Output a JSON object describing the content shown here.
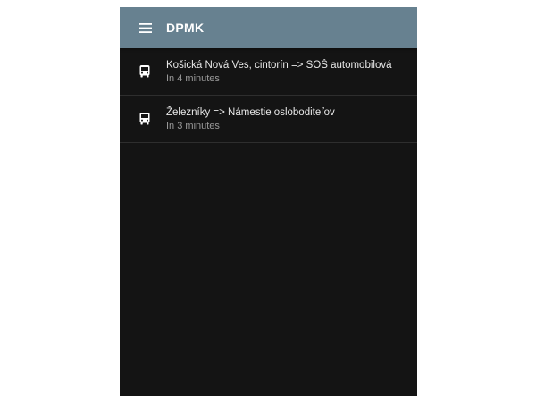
{
  "app": {
    "title": "DPMK"
  },
  "colors": {
    "appbar": "#678190",
    "background": "#141414",
    "primary_text": "#e8e8e8",
    "secondary_text": "#9a9a9a"
  },
  "icons": {
    "menu": "hamburger-menu-icon",
    "bus": "bus-icon"
  },
  "departures": [
    {
      "route": "Košická Nová Ves,  cintorín => SOŠ automobilová",
      "eta": "In 4 minutes"
    },
    {
      "route": "Železníky => Námestie osloboditeľov",
      "eta": "In 3 minutes"
    }
  ]
}
